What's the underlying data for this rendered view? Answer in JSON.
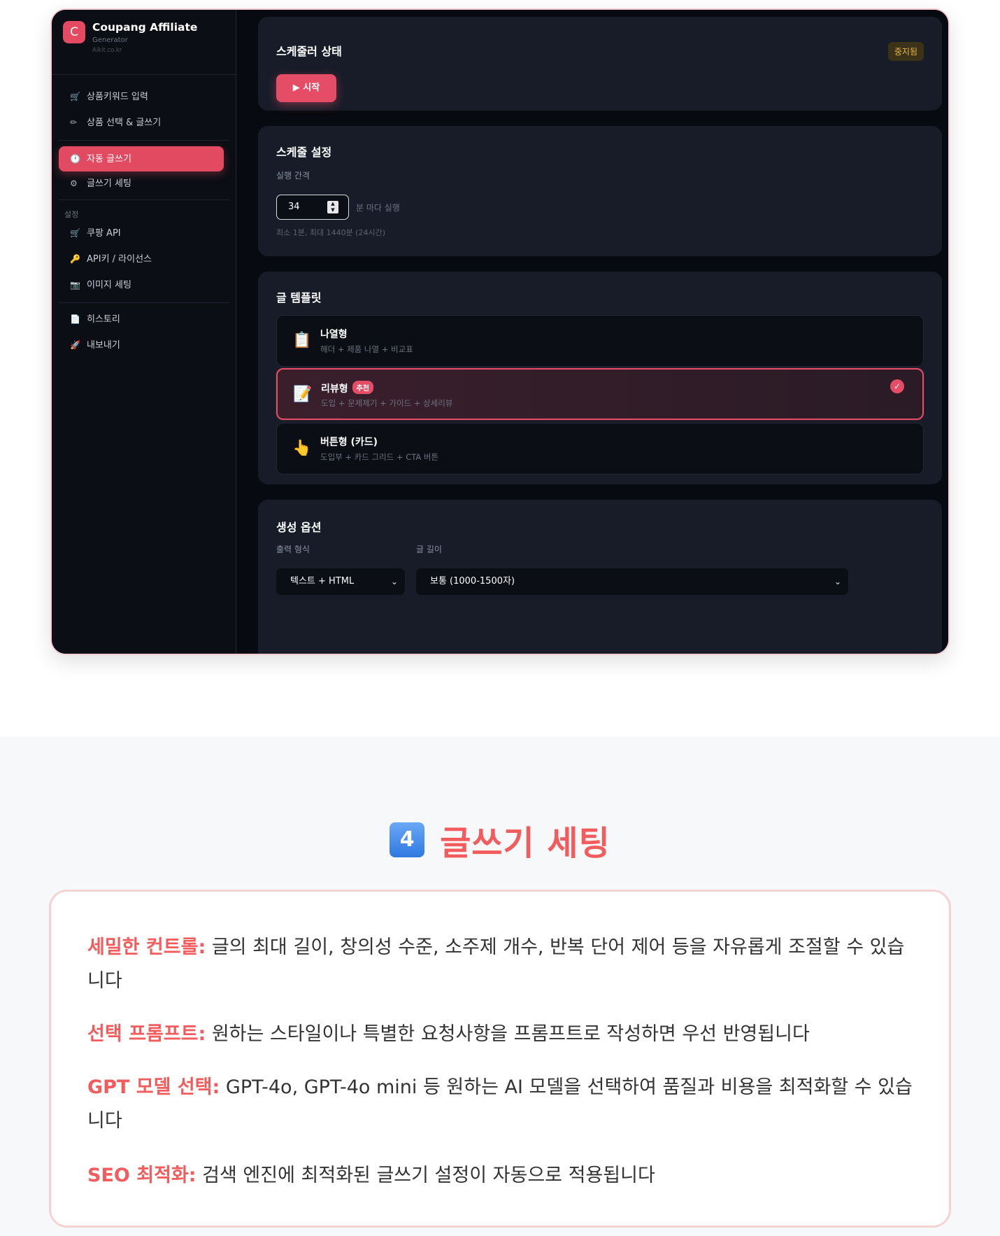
{
  "app": {
    "brand": {
      "logo_letter": "C",
      "title": "Coupang Affiliate",
      "subtitle": "Generator",
      "url": "Aikit.co.kr"
    },
    "sidebar": {
      "items": [
        {
          "icon": "cart-icon",
          "glyph": "🛒",
          "label": "상품키워드 입력"
        },
        {
          "icon": "pencil-icon",
          "glyph": "✏",
          "label": "상품 선택 & 글쓰기"
        },
        {
          "icon": "clock-icon",
          "glyph": "🕐",
          "label": "자동 글쓰기",
          "active": true
        },
        {
          "icon": "gear-icon",
          "glyph": "⚙",
          "label": "글쓰기 세팅"
        },
        {
          "icon": "cart-icon",
          "glyph": "🛒",
          "label": "쿠팡 API"
        },
        {
          "icon": "key-icon",
          "glyph": "🔑",
          "label": "API키 / 라이선스"
        },
        {
          "icon": "camera-icon",
          "glyph": "📷",
          "label": "이미지 세팅"
        },
        {
          "icon": "document-icon",
          "glyph": "📄",
          "label": "히스토리"
        },
        {
          "icon": "rocket-icon",
          "glyph": "🚀",
          "label": "내보내기"
        }
      ],
      "settings_label": "설정"
    },
    "scheduler": {
      "title": "스케줄러 상태",
      "status_badge": "중지됨",
      "start_button": "▶ 시작"
    },
    "schedule_settings": {
      "title": "스케줄 설정",
      "interval_label": "실행 간격",
      "interval_value": "34",
      "interval_unit": "분 마다 실행",
      "hint": "최소 1분, 최대 1440분 (24시간)"
    },
    "templates": {
      "title": "글 템플릿",
      "items": [
        {
          "icon": "clipboard-icon",
          "glyph": "📋",
          "name": "나열형",
          "desc": "헤더 + 제품 나열 + 비교표",
          "badge": "",
          "selected": false
        },
        {
          "icon": "memo-icon",
          "glyph": "📝",
          "name": "리뷰형",
          "desc": "도입 + 문제제기 + 가이드 + 상세리뷰",
          "badge": "추천",
          "selected": true
        },
        {
          "icon": "pointing-hand-icon",
          "glyph": "👆",
          "name": "버튼형 (카드)",
          "desc": "도입부 + 카드 그리드 + CTA 버튼",
          "badge": "",
          "selected": false
        }
      ]
    },
    "generation_options": {
      "title": "생성 옵션",
      "output_format_label": "출력 형식",
      "output_format_value": "텍스트 + HTML",
      "length_label": "글 길이",
      "length_value": "보통 (1000-1500자)"
    }
  },
  "section": {
    "number": "4",
    "title": "글쓰기 세팅",
    "features": [
      {
        "key": "세밀한 컨트롤:",
        "text": " 글의 최대 길이, 창의성 수준, 소주제 개수, 반복 단어 제어 등을 자유롭게 조절할 수 있습니다"
      },
      {
        "key": "선택 프롬프트:",
        "text": " 원하는 스타일이나 특별한 요청사항을 프롬프트로 작성하면 우선 반영됩니다"
      },
      {
        "key": "GPT 모델 선택:",
        "text": " GPT-4o, GPT-4o mini 등 원하는 AI 모델을 선택하여 품질과 비용을 최적화할 수 있습니다"
      },
      {
        "key": "SEO 최적화:",
        "text": " 검색 엔진에 최적화된 글쓰기 설정이 자동으로 적용됩니다"
      }
    ]
  },
  "colors": {
    "accent": "#e54d66",
    "heading_red": "#f25c5c",
    "app_bg": "#0c0f17",
    "card_bg": "#171c28"
  }
}
